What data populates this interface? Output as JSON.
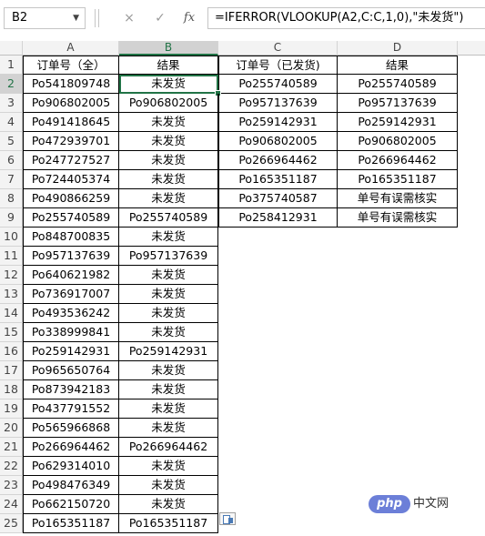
{
  "formula_bar": {
    "name_box": "B2",
    "cancel_icon": "×",
    "enter_icon": "✓",
    "fx_label": "fx",
    "formula": "=IFERROR(VLOOKUP(A2,C:C,1,0),\"未发货\")"
  },
  "columns": [
    "A",
    "B",
    "C",
    "D"
  ],
  "selected_column": "B",
  "selected_row": "2",
  "rows": [
    {
      "n": "1",
      "a": "订单号（全）",
      "b": "结果",
      "c": "订单号（已发货)",
      "d": "结果"
    },
    {
      "n": "2",
      "a": "Po541809748",
      "b": "未发货",
      "c": "Po255740589",
      "d": "Po255740589"
    },
    {
      "n": "3",
      "a": "Po906802005",
      "b": "Po906802005",
      "c": "Po957137639",
      "d": "Po957137639"
    },
    {
      "n": "4",
      "a": "Po491418645",
      "b": "未发货",
      "c": "Po259142931",
      "d": "Po259142931"
    },
    {
      "n": "5",
      "a": "Po472939701",
      "b": "未发货",
      "c": "Po906802005",
      "d": "Po906802005"
    },
    {
      "n": "6",
      "a": "Po247727527",
      "b": "未发货",
      "c": "Po266964462",
      "d": "Po266964462"
    },
    {
      "n": "7",
      "a": "Po724405374",
      "b": "未发货",
      "c": "Po165351187",
      "d": "Po165351187"
    },
    {
      "n": "8",
      "a": "Po490866259",
      "b": "未发货",
      "c": "Po375740587",
      "d": "单号有误需核实"
    },
    {
      "n": "9",
      "a": "Po255740589",
      "b": "Po255740589",
      "c": "Po258412931",
      "d": "单号有误需核实"
    },
    {
      "n": "10",
      "a": "Po848700835",
      "b": "未发货"
    },
    {
      "n": "11",
      "a": "Po957137639",
      "b": "Po957137639"
    },
    {
      "n": "12",
      "a": "Po640621982",
      "b": "未发货"
    },
    {
      "n": "13",
      "a": "Po736917007",
      "b": "未发货"
    },
    {
      "n": "14",
      "a": "Po493536242",
      "b": "未发货"
    },
    {
      "n": "15",
      "a": "Po338999841",
      "b": "未发货"
    },
    {
      "n": "16",
      "a": "Po259142931",
      "b": "Po259142931"
    },
    {
      "n": "17",
      "a": "Po965650764",
      "b": "未发货"
    },
    {
      "n": "18",
      "a": "Po873942183",
      "b": "未发货"
    },
    {
      "n": "19",
      "a": "Po437791552",
      "b": "未发货"
    },
    {
      "n": "20",
      "a": "Po565966868",
      "b": "未发货"
    },
    {
      "n": "21",
      "a": "Po266964462",
      "b": "Po266964462"
    },
    {
      "n": "22",
      "a": "Po629314010",
      "b": "未发货"
    },
    {
      "n": "23",
      "a": "Po498476349",
      "b": "未发货"
    },
    {
      "n": "24",
      "a": "Po662150720",
      "b": "未发货"
    },
    {
      "n": "25",
      "a": "Po165351187",
      "b": "Po165351187"
    }
  ],
  "watermark": {
    "logo": "php",
    "text": "中文网"
  },
  "colors": {
    "accent": "#217346",
    "header_bg": "#f3f3f3",
    "header_selected_bg": "#d2d2d2"
  }
}
